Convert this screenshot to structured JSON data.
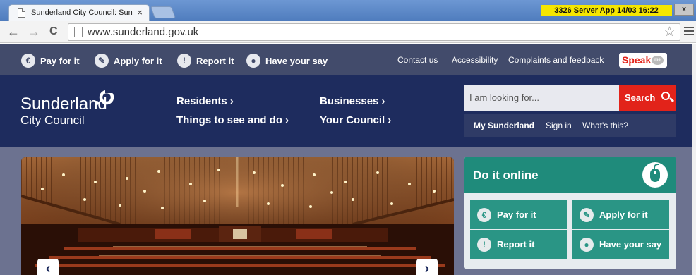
{
  "browser": {
    "tab_title": "Sunderland City Council: Sun",
    "tab_close": "×",
    "server_badge": "3326 Server App 14/03 16:22",
    "window_close": "x",
    "url": "www.sunderland.gov.uk",
    "back": "←",
    "forward": "→",
    "reload": "C",
    "star": "☆"
  },
  "topbar": {
    "quick_links": [
      {
        "label": "Pay for it",
        "icon": "euro-icon",
        "glyph": "€"
      },
      {
        "label": "Apply for it",
        "icon": "pencil-icon",
        "glyph": "✎"
      },
      {
        "label": "Report it",
        "icon": "exclamation-icon",
        "glyph": "!"
      },
      {
        "label": "Have your say",
        "icon": "speech-bubble-icon",
        "glyph": "●"
      }
    ],
    "links": [
      "Contact us",
      "Accessibility",
      "Complaints and feedback"
    ],
    "speak_label": "Speak",
    "speak_bubble": "me"
  },
  "header": {
    "logo_line1": "Sunderland",
    "logo_line2": "City Council",
    "nav": [
      "Residents ›",
      "Businesses ›",
      "Things to see and do ›",
      "Your Council ›"
    ],
    "search_placeholder": "I am looking for...",
    "search_button": "Search",
    "my_sunderland": "My Sunderland",
    "sign_in": "Sign in",
    "whats_this": "What's this?"
  },
  "slider": {
    "prev": "‹",
    "next": "›"
  },
  "do_it_online": {
    "title": "Do it online",
    "tiles": [
      {
        "label": "Pay for it",
        "icon": "euro-icon",
        "glyph": "€"
      },
      {
        "label": "Apply for it",
        "icon": "pencil-icon",
        "glyph": "✎"
      },
      {
        "label": "Report it",
        "icon": "exclamation-icon",
        "glyph": "!"
      },
      {
        "label": "Have your say",
        "icon": "speech-bubble-icon",
        "glyph": "●"
      }
    ]
  },
  "colors": {
    "topbar": "#424b6b",
    "header": "#1e2c5e",
    "accent_red": "#e2231a",
    "teal": "#1f8b7b"
  }
}
